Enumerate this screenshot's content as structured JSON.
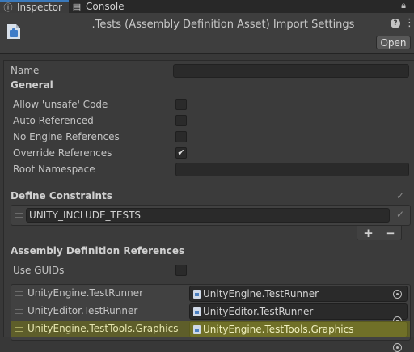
{
  "tabs": [
    {
      "label": "Inspector",
      "icon": "info-icon"
    },
    {
      "label": "Console",
      "icon": "console-icon"
    }
  ],
  "header": {
    "title": ".Tests (Assembly Definition Asset) Import Settings",
    "open_label": "Open"
  },
  "fields": {
    "name_label": "Name",
    "name_value": "",
    "general_section": "General",
    "allow_unsafe_label": "Allow 'unsafe' Code",
    "auto_referenced_label": "Auto Referenced",
    "no_engine_refs_label": "No Engine References",
    "override_refs_label": "Override References",
    "root_namespace_label": "Root Namespace",
    "root_namespace_value": ""
  },
  "checkboxes": {
    "allow_unsafe": false,
    "auto_referenced": false,
    "no_engine_refs": false,
    "override_refs": true,
    "use_guids": false
  },
  "define_constraints": {
    "title": "Define Constraints",
    "items": [
      "UNITY_INCLUDE_TESTS"
    ],
    "add_label": "+",
    "remove_label": "−"
  },
  "assembly_refs": {
    "title": "Assembly Definition References",
    "use_guids_label": "Use GUIDs",
    "items": [
      {
        "name": "UnityEngine.TestRunner",
        "value": "UnityEngine.TestRunner"
      },
      {
        "name": "UnityEditor.TestRunner",
        "value": "UnityEditor.TestRunner"
      },
      {
        "name": "UnityEngine.TestTools.Graphics",
        "value": "UnityEngine.TestTools.Graphics"
      }
    ]
  },
  "colors": {
    "accent": "#3a79bb",
    "highlight_row": "#5e5e2a"
  }
}
